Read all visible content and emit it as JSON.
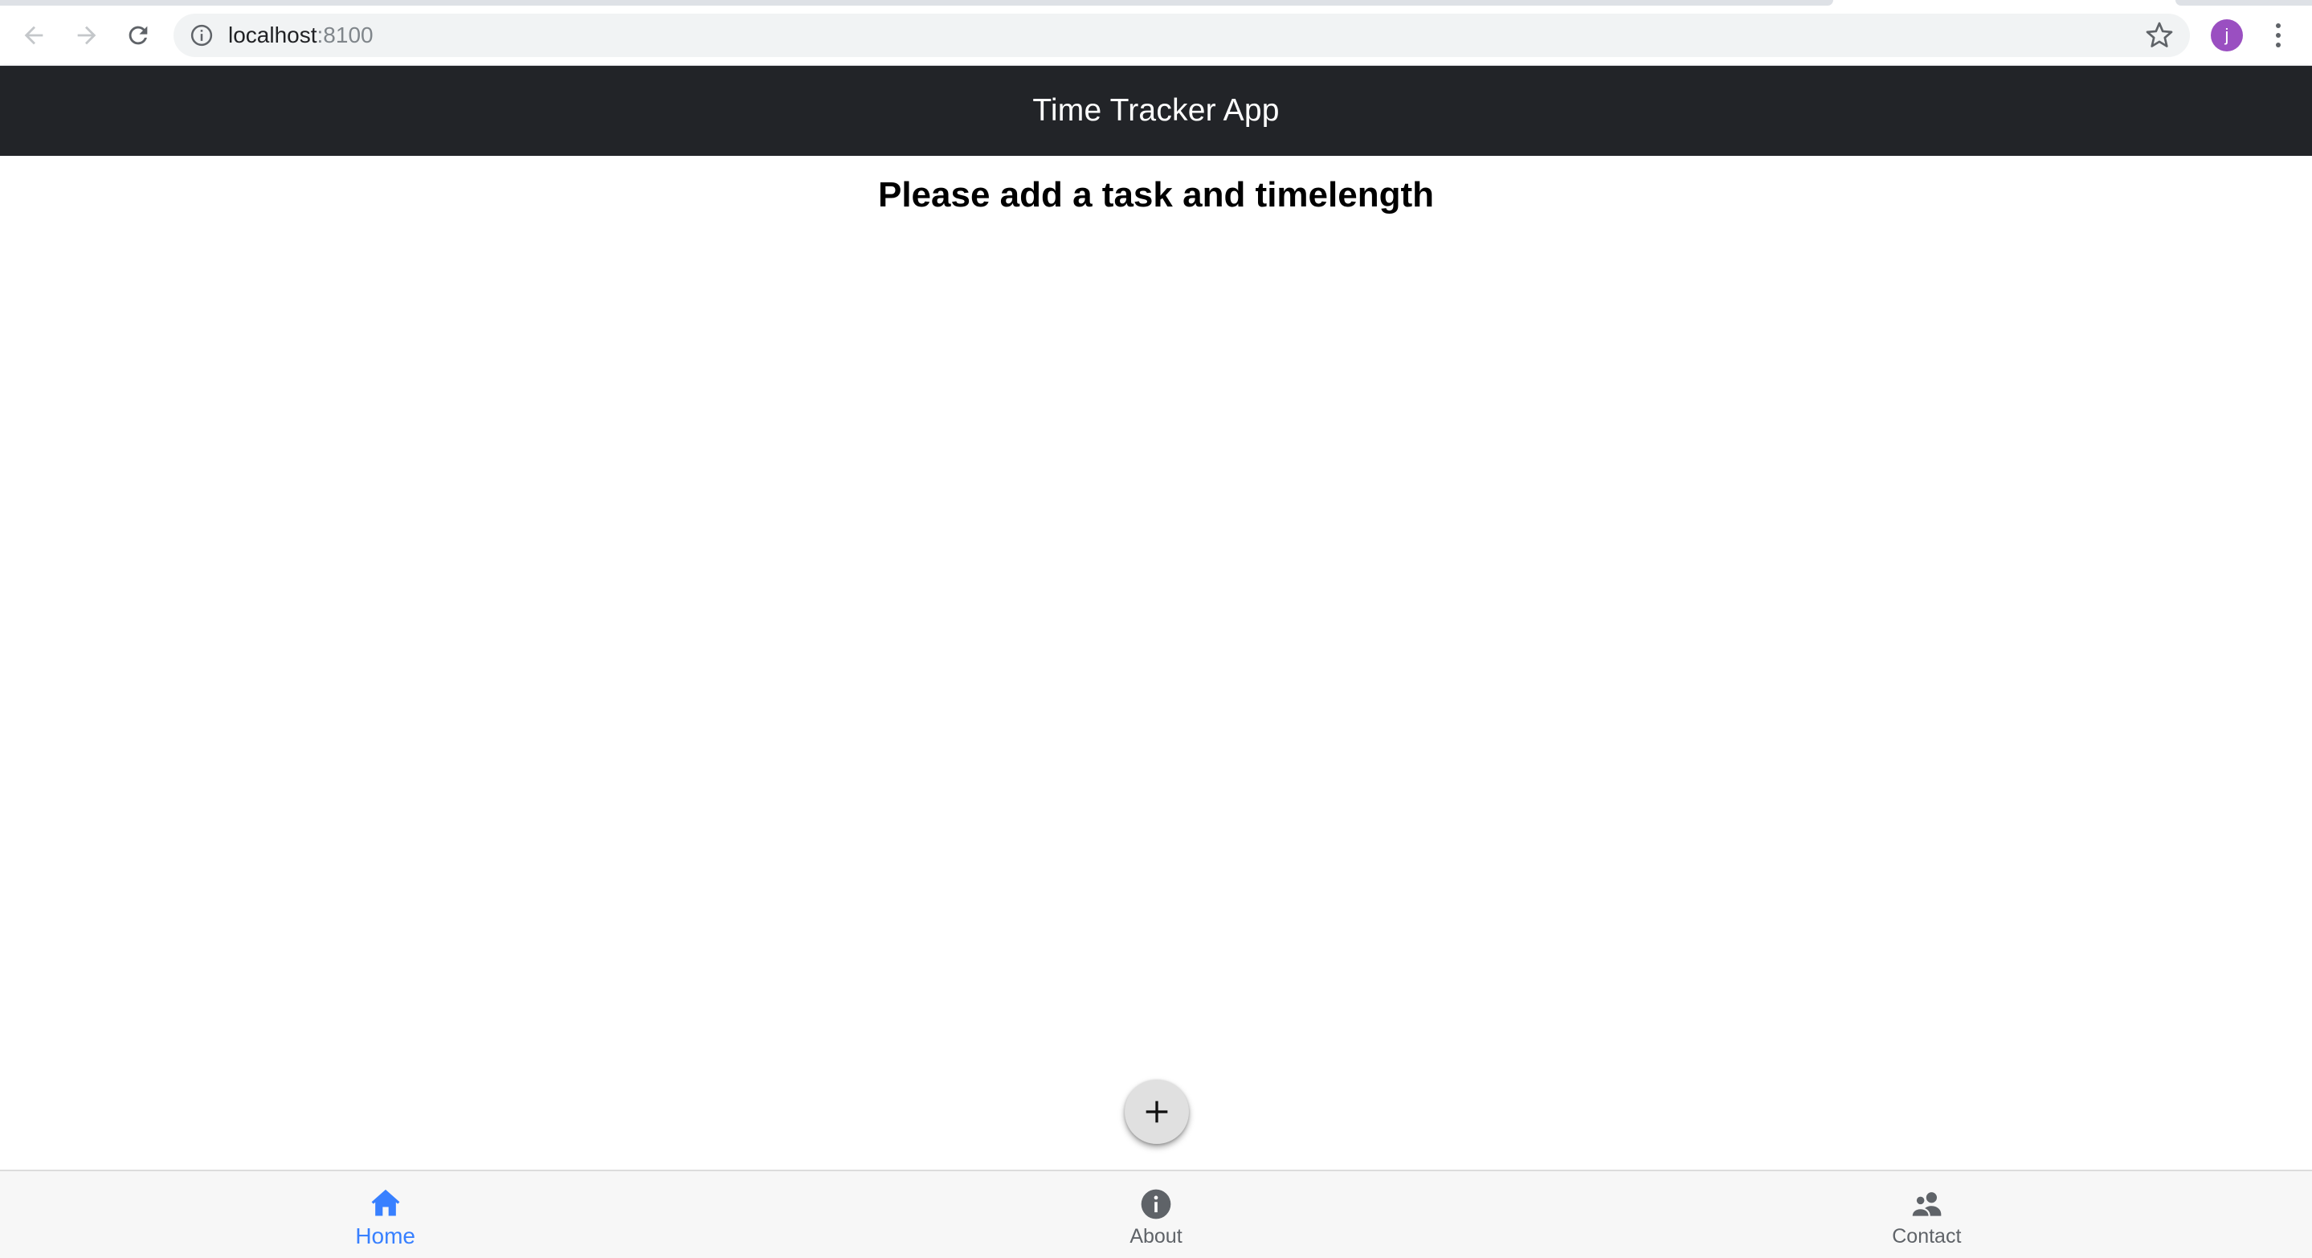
{
  "browser": {
    "url_host": "localhost",
    "url_port": ":8100",
    "profile_initial": "j"
  },
  "app": {
    "title": "Time Tracker App"
  },
  "main": {
    "empty_message": "Please add a task and timelength"
  },
  "fab": {
    "icon": "add-icon"
  },
  "tabs": [
    {
      "label": "Home",
      "icon": "home-icon",
      "active": true
    },
    {
      "label": "About",
      "icon": "information-circle-icon",
      "active": false
    },
    {
      "label": "Contact",
      "icon": "people-icon",
      "active": false
    }
  ],
  "colors": {
    "toolbar_bg": "#222428",
    "tab_active": "#3880ff",
    "profile_avatar": "#9a4fc1"
  }
}
